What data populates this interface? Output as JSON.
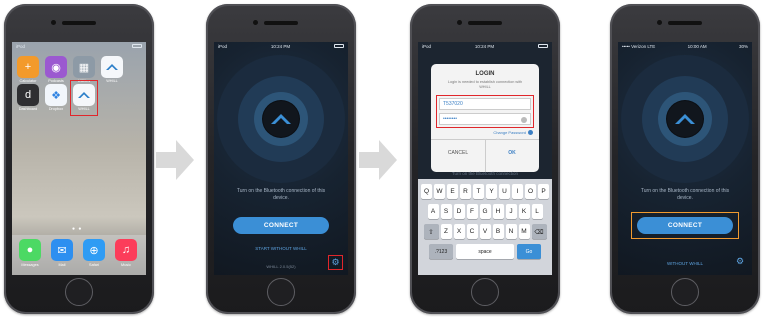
{
  "steps": {
    "home": {
      "statusbar": {
        "left": "iPod",
        "time": "",
        "right": ""
      },
      "apps": [
        {
          "label": "Calculator",
          "icon": "calculator-icon",
          "color": "#f39a2b",
          "glyph": "+"
        },
        {
          "label": "Podcasts",
          "icon": "podcasts-icon",
          "color": "#9b59d0",
          "glyph": "◉"
        },
        {
          "label": "Utilities",
          "icon": "utilities-folder-icon",
          "color": "#8d9aa6",
          "glyph": "▦"
        },
        {
          "label": "WHILL",
          "icon": "whill-app-icon",
          "color": "#f5f7fa",
          "glyph": ""
        },
        {
          "label": "Dashboard",
          "icon": "dashboard-app-icon",
          "color": "#2f2f32",
          "glyph": "d"
        },
        {
          "label": "Dropbox",
          "icon": "dropbox-icon",
          "color": "#f2f6fb",
          "glyph": "❖"
        },
        {
          "label": "WHILL",
          "icon": "whill-app-icon-highlighted",
          "color": "#f5f7fa",
          "glyph": ""
        }
      ],
      "dock": [
        {
          "label": "Messages",
          "icon": "messages-icon",
          "color": "#4cd964",
          "glyph": "●"
        },
        {
          "label": "Mail",
          "icon": "mail-icon",
          "color": "#2d8ff0",
          "glyph": "✉"
        },
        {
          "label": "Safari",
          "icon": "safari-icon",
          "color": "#2f9cf4",
          "glyph": "⊕"
        },
        {
          "label": "Music",
          "icon": "music-icon",
          "color": "#fc3d5a",
          "glyph": "♫"
        }
      ]
    },
    "connect": {
      "statusbar": {
        "left": "iPod",
        "time": "10:24 PM",
        "right": ""
      },
      "message": "Turn on the Bluetooth connection of this device.",
      "connect_label": "CONNECT",
      "without_label": "START WITHOUT WHILL",
      "version": "WHILL 2.0.5(52)"
    },
    "login": {
      "statusbar": {
        "left": "iPod",
        "time": "10:24 PM",
        "right": ""
      },
      "title": "LOGIN",
      "subtitle": "Login is needed to establish connection with WHILL",
      "id_value": "T537020",
      "password_value": "••••••••",
      "change_password": "Change Password",
      "cancel_label": "CANCEL",
      "ok_label": "OK",
      "behind_text": "Turn on the Bluetooth connection",
      "keyboard": {
        "row1": [
          "Q",
          "W",
          "E",
          "R",
          "T",
          "Y",
          "U",
          "I",
          "O",
          "P"
        ],
        "row2": [
          "A",
          "S",
          "D",
          "F",
          "G",
          "H",
          "J",
          "K",
          "L"
        ],
        "row3": [
          "Z",
          "X",
          "C",
          "V",
          "B",
          "N",
          "M"
        ],
        "numbers_key": ".?123",
        "space_key": "space",
        "go_key": "Go",
        "shift_glyph": "⇧",
        "delete_glyph": "⌫"
      }
    },
    "final": {
      "statusbar": {
        "left": "••••• Verizon LTE",
        "time": "10:00 AM",
        "right": "30%"
      },
      "message": "Turn on the Bluetooth connection of this device.",
      "connect_label": "CONNECT",
      "without_label": "WITHOUT WHILL"
    }
  },
  "colors": {
    "highlight_red": "#e0262b",
    "highlight_orange": "#f09a2f",
    "accent_blue": "#3b8fd6",
    "arrow_gray": "#d9d9d9"
  }
}
